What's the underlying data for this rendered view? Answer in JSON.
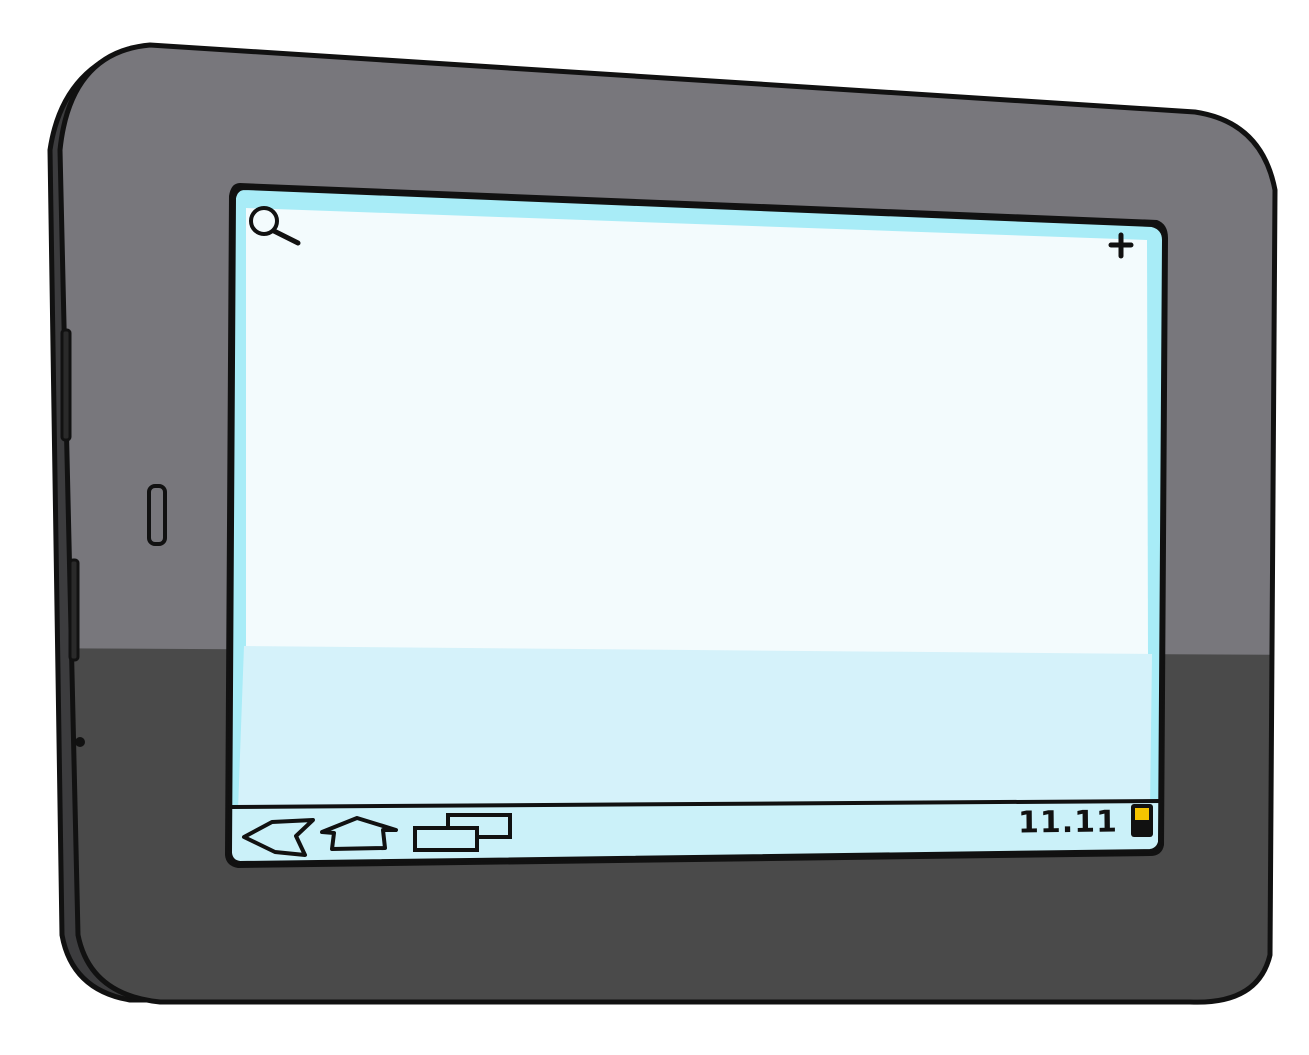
{
  "device": {
    "type": "tablet",
    "colors": {
      "bezel_upper": "#78777c",
      "bezel_lower": "#4a4a4a",
      "outline": "#111111",
      "screen_frame": "#a8ecf7",
      "screen_body": "#f3fbfd",
      "screen_lower": "#d5f2fa",
      "nav_bar": "#cbf1f9",
      "battery": "#f5c400"
    }
  },
  "screen": {
    "top_bar": {
      "search_icon": "search-icon",
      "add_icon": "plus-icon"
    }
  },
  "nav_bar": {
    "back_icon": "back-icon",
    "home_icon": "home-icon",
    "recents_icon": "recent-apps-icon",
    "clock": "11.11",
    "battery_icon": "battery-icon"
  }
}
